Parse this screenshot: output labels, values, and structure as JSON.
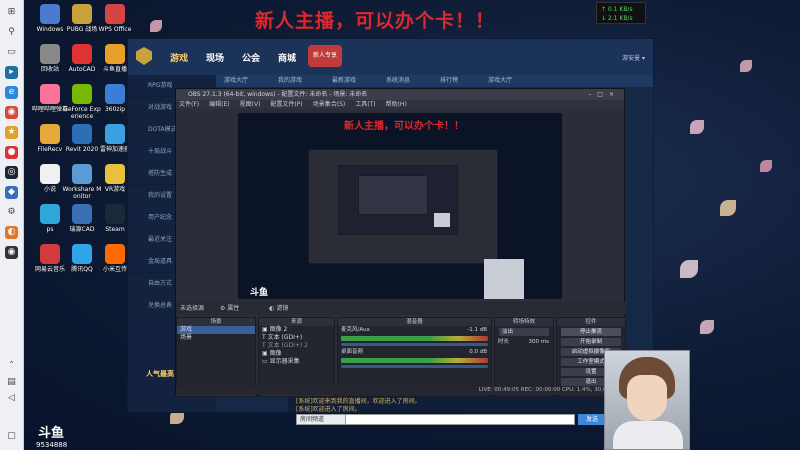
{
  "banner": {
    "text": "新人主播，可以办个卡！！"
  },
  "netspeed": {
    "up": "↑ 0.1 KB/s",
    "down": "↓ 2.1 KB/s"
  },
  "desktop_icons": [
    {
      "label": "Windows",
      "color": "#4a7bd0"
    },
    {
      "label": "PUBG 战场",
      "color": "#c8a23d"
    },
    {
      "label": "WPS Office",
      "color": "#d64545"
    },
    {
      "label": "回收站",
      "color": "#888888"
    },
    {
      "label": "AutoCAD",
      "color": "#d33"
    },
    {
      "label": "斗鱼直播",
      "color": "#e8a02a"
    },
    {
      "label": "哔哩哔哩弹幕",
      "color": "#fb7299"
    },
    {
      "label": "GeForce Experience",
      "color": "#76b900"
    },
    {
      "label": "360zip",
      "color": "#3b7ed8"
    },
    {
      "label": "FileRecv",
      "color": "#e6a93a"
    },
    {
      "label": "Revit 2020",
      "color": "#2d6fb7"
    },
    {
      "label": "雷神加速器",
      "color": "#3aa0e0"
    },
    {
      "label": "小说",
      "color": "#f0f0f0"
    },
    {
      "label": "Workshare Monitor",
      "color": "#5a9bd4"
    },
    {
      "label": "VR游戏",
      "color": "#e8c23a"
    },
    {
      "label": "ps",
      "color": "#2fa6d9"
    },
    {
      "label": "瑞源CAD",
      "color": "#3a6fb5"
    },
    {
      "label": "Steam",
      "color": "#1b2838"
    },
    {
      "label": "网易云音乐",
      "color": "#d13b3b"
    },
    {
      "label": "腾讯QQ",
      "color": "#2fa4e7"
    },
    {
      "label": "小米互传",
      "color": "#ff6900"
    }
  ],
  "launcher": {
    "tabs": [
      "游戏",
      "现场",
      "公会",
      "商城"
    ],
    "badge": "新人专享",
    "user": "游安曼 ▾",
    "subnav": [
      "游戏大厅",
      "我的游戏",
      "最新游戏",
      "系统消息",
      "排行榜",
      "游戏大厅"
    ],
    "side": [
      "RPG游戏",
      "对战游戏",
      "DOTA模式",
      "十局战斗",
      "塔防生成",
      "我的设置",
      "用户纪念",
      "最近关注",
      "金局道具",
      "自由方式",
      "兑换总表"
    ],
    "brand": "人气最高",
    "chat_lines": [
      "[系统]欢迎来到我的直播间，欢迎进入了房间。",
      "[系统]欢迎进入了房间。"
    ],
    "channel": "房间频道",
    "send": "发送"
  },
  "obs": {
    "title": "OBS 27.1.3 (64-bit, windows) - 配置文件: 未命名 - 场景: 未命名",
    "menu": [
      "文件(F)",
      "编辑(E)",
      "视图(V)",
      "配置文件(P)",
      "场景集合(S)",
      "工具(T)",
      "帮助(H)"
    ],
    "scene_bar": [
      "未选择源",
      "属性",
      "滤镜"
    ],
    "docks": {
      "scenes": {
        "title": "场景",
        "items": [
          "游戏",
          "场景"
        ]
      },
      "sources": {
        "title": "来源",
        "items": [
          "图像 2",
          "文本 (GDI+)",
          "文本 (GDI+) 2",
          "图像",
          "显示器采集"
        ]
      },
      "mixer": {
        "title": "混音器",
        "channels": [
          {
            "name": "麦克风/Aux",
            "db": "-1.1 dB"
          },
          {
            "name": "桌面音频",
            "db": "0.0 dB"
          }
        ]
      },
      "transitions": {
        "title": "转场特效",
        "type": "淡出",
        "duration_label": "时长",
        "duration": "300 ms"
      },
      "controls": {
        "title": "控件",
        "buttons": [
          "停止推流",
          "开始录制",
          "启动虚拟摄像机",
          "工作室模式",
          "设置",
          "退出"
        ]
      }
    },
    "status": "LIVE: 00:49:05   REC: 00:00:00   CPU: 1.4%, 30.00 fps"
  },
  "douyu": {
    "logo": "斗鱼",
    "id": "9534888"
  }
}
